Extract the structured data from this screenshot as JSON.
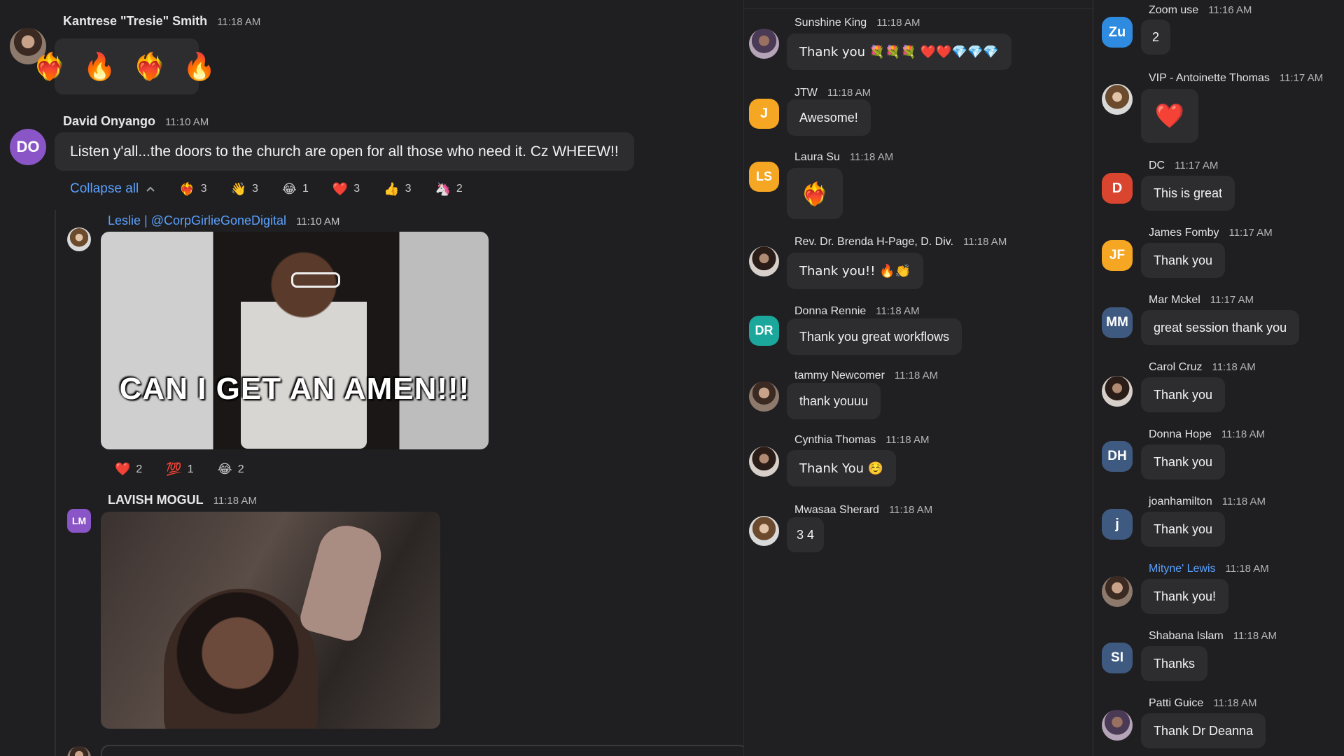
{
  "left": {
    "messages": [
      {
        "name": "Kantrese \"Tresie\" Smith",
        "time": "11:18 AM",
        "content": "❤️‍🔥 🔥 ❤️‍🔥 🔥"
      },
      {
        "name": "David Onyango",
        "time": "11:10 AM",
        "initials": "DO",
        "text": "Listen y'all...the doors to the church are open for all those who need it. Cz WHEEW!!"
      }
    ],
    "collapse_label": "Collapse all",
    "reactions": [
      {
        "emoji": "❤️‍🔥",
        "count": "3"
      },
      {
        "emoji": "👋",
        "count": "3"
      },
      {
        "emoji": "😂",
        "count": "1"
      },
      {
        "emoji": "❤️",
        "count": "3"
      },
      {
        "emoji": "👍",
        "count": "3"
      },
      {
        "emoji": "🦄",
        "count": "2"
      }
    ],
    "thread": [
      {
        "name": "Leslie | @CorpGirlieGoneDigital",
        "time": "11:10 AM",
        "gif_caption": "CAN I GET AN AMEN!!!",
        "reactions": [
          {
            "emoji": "❤️",
            "count": "2"
          },
          {
            "emoji": "💯",
            "count": "1"
          },
          {
            "emoji": "😂",
            "count": "2"
          }
        ]
      },
      {
        "name": "LAVISH MOGUL",
        "time": "11:18 AM",
        "initials": "LM"
      }
    ]
  },
  "middle": {
    "messages": [
      {
        "name": "Sunshine King",
        "time": "11:18 AM",
        "text": "Thank you 💐💐💐 ❤️❤️💎💎💎"
      },
      {
        "name": "JTW",
        "time": "11:18 AM",
        "initials": "J",
        "color": "#f5a623",
        "text": "Awesome!"
      },
      {
        "name": "Laura Su",
        "time": "11:18 AM",
        "initials": "LS",
        "color": "#f5a623",
        "text": "❤️‍🔥"
      },
      {
        "name": "Rev. Dr. Brenda H-Page, D. Div.",
        "time": "11:18 AM",
        "text": "Thank you!! 🔥👏"
      },
      {
        "name": "Donna Rennie",
        "time": "11:18 AM",
        "initials": "DR",
        "color": "#1ba79b",
        "text": "Thank you great workflows"
      },
      {
        "name": "tammy Newcomer",
        "time": "11:18 AM",
        "text": "thank youuu"
      },
      {
        "name": "Cynthia Thomas",
        "time": "11:18 AM",
        "text": "Thank You ☺️"
      },
      {
        "name": "Mwasaa Sherard",
        "time": "11:18 AM",
        "text": "3 4"
      }
    ]
  },
  "right": {
    "messages": [
      {
        "name": "Zoom use",
        "time": "11:16 AM",
        "initials": "Zu",
        "color": "#2e8be0",
        "text": "2"
      },
      {
        "name": "VIP - Antoinette Thomas",
        "time": "11:17 AM",
        "text": "❤️"
      },
      {
        "name": "DC",
        "time": "11:17 AM",
        "initials": "D",
        "color": "#d9452f",
        "text": "This is great"
      },
      {
        "name": "James Fomby",
        "time": "11:17 AM",
        "initials": "JF",
        "color": "#f5a623",
        "text": "Thank you"
      },
      {
        "name": "Mar Mckel",
        "time": "11:17 AM",
        "initials": "MM",
        "color": "#3f5a80",
        "text": "great session thank you"
      },
      {
        "name": "Carol Cruz",
        "time": "11:18 AM",
        "text": "Thank you"
      },
      {
        "name": "Donna Hope",
        "time": "11:18 AM",
        "initials": "DH",
        "color": "#3f5a80",
        "text": "Thank you"
      },
      {
        "name": "joanhamilton",
        "time": "11:18 AM",
        "initials": "j",
        "color": "#3f5a80",
        "text": "Thank you"
      },
      {
        "name": "Mityne' Lewis",
        "time": "11:18 AM",
        "text": "Thank you!"
      },
      {
        "name": "Shabana Islam",
        "time": "11:18 AM",
        "initials": "SI",
        "color": "#3f5a80",
        "text": "Thanks"
      },
      {
        "name": "Patti Guice",
        "time": "11:18 AM",
        "text": "Thank Dr Deanna"
      }
    ]
  }
}
